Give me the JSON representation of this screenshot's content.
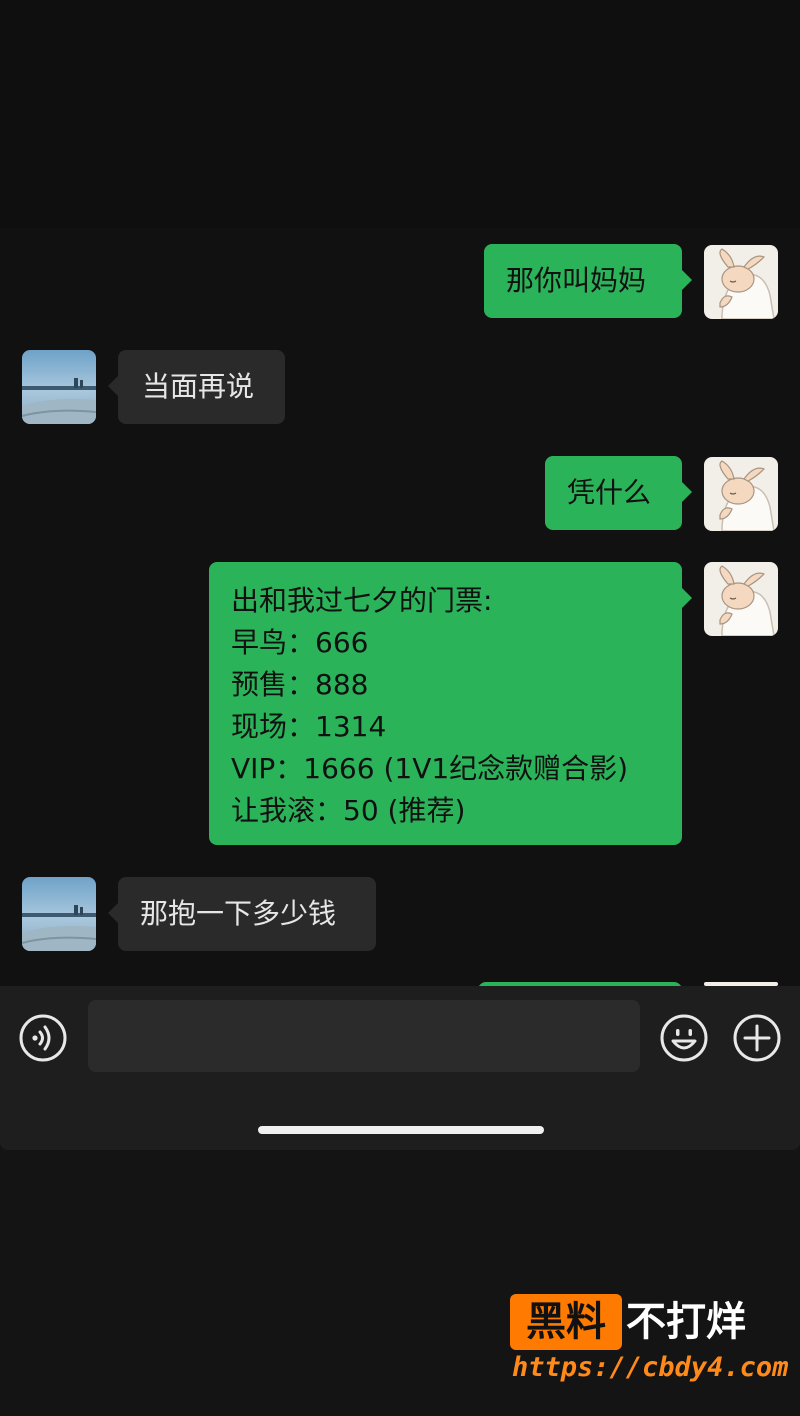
{
  "messages": [
    {
      "side": "me",
      "text": "那你叫妈妈"
    },
    {
      "side": "other",
      "text": "当面再说"
    },
    {
      "side": "me",
      "text": "凭什么"
    },
    {
      "side": "me",
      "lines": [
        "出和我过七夕的门票:",
        "早鸟：666",
        "预售：888",
        "现场：1314",
        "VIP：1666 (1V1纪念款赠合影)",
        "让我滚：50 (推荐)"
      ]
    },
    {
      "side": "other",
      "text": "那抱一下多少钱"
    }
  ],
  "input": {
    "placeholder": ""
  },
  "icons": {
    "voice": "voice-icon",
    "emoji": "emoji-icon",
    "add": "plus-icon"
  },
  "watermark": {
    "badge": "黑料",
    "text": "不打烊",
    "url": "https://cbdy4.com"
  },
  "colors": {
    "me_bubble": "#2bb35a",
    "other_bubble": "#2a2a2a",
    "accent": "#ff7a00"
  }
}
